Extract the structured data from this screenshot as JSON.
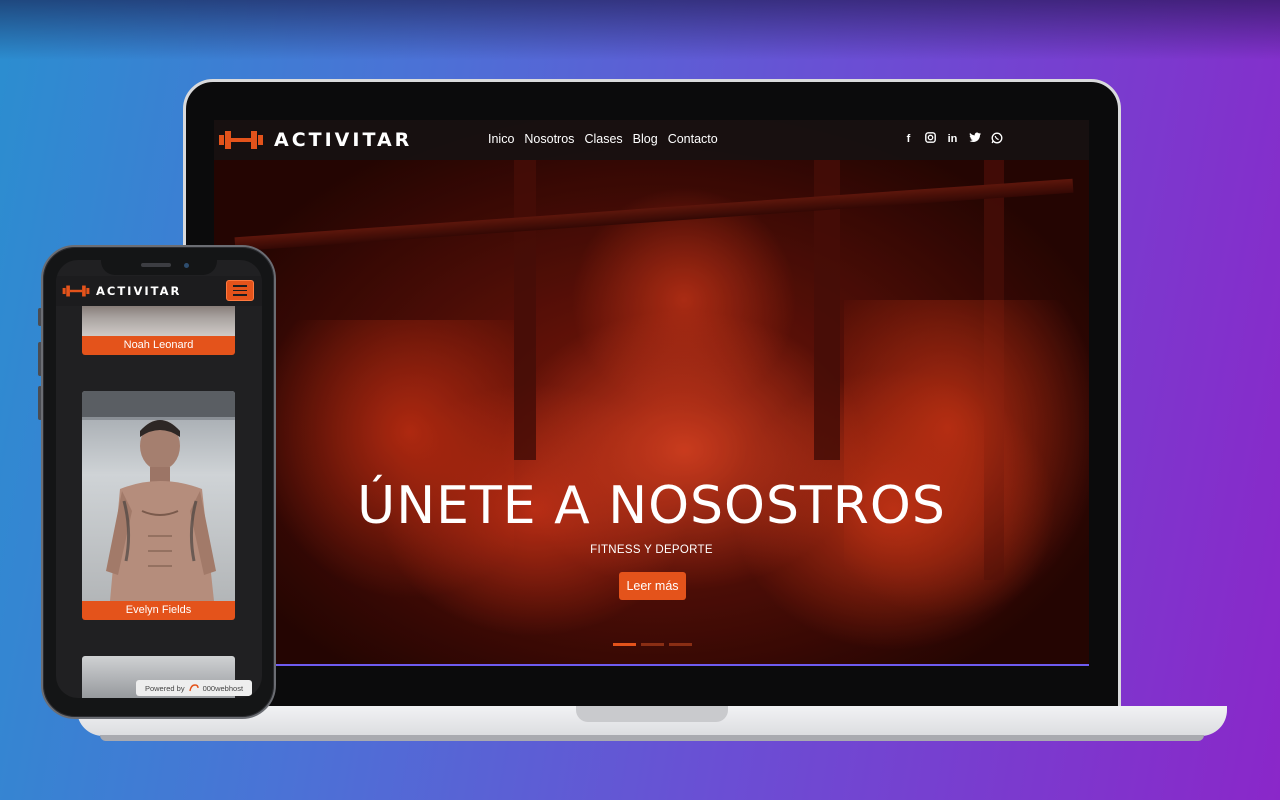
{
  "site": {
    "brand": "ACTIVITAR",
    "nav": [
      "Inico",
      "Nosotros",
      "Clases",
      "Blog",
      "Contacto"
    ],
    "social_icons": [
      "facebook-icon",
      "instagram-icon",
      "linkedin-icon",
      "twitter-icon",
      "whatsapp-icon"
    ],
    "hero": {
      "title": "ÚNETE A NOSOSTROS",
      "subtitle": "FITNESS Y DEPORTE",
      "button": "Leer más",
      "slides": 3,
      "active_slide": 1
    }
  },
  "mobile": {
    "brand": "ACTIVITAR",
    "cards": [
      {
        "name": "Noah Leonard"
      },
      {
        "name": "Evelyn Fields"
      }
    ],
    "powered_label": "Powered by",
    "powered_brand": "000webhost"
  },
  "colors": {
    "accent": "#e4531b",
    "background_start": "#2b8ed0",
    "background_end": "#8a27c9"
  }
}
